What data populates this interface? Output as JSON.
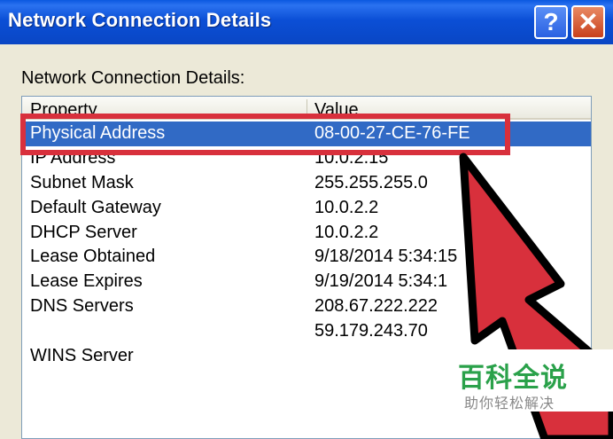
{
  "window": {
    "title": "Network Connection Details",
    "help_label": "?",
    "close_label": "✕"
  },
  "panel": {
    "group_label": "Network Connection Details:"
  },
  "table": {
    "columns": [
      "Property",
      "Value"
    ],
    "rows": [
      {
        "property": "Physical Address",
        "value": "08-00-27-CE-76-FE"
      },
      {
        "property": "IP Address",
        "value": "10.0.2.15"
      },
      {
        "property": "Subnet Mask",
        "value": "255.255.255.0"
      },
      {
        "property": "Default Gateway",
        "value": "10.0.2.2"
      },
      {
        "property": "DHCP Server",
        "value": "10.0.2.2"
      },
      {
        "property": "Lease Obtained",
        "value": "9/18/2014 5:34:15"
      },
      {
        "property": "Lease Expires",
        "value": "9/19/2014 5:34:1"
      },
      {
        "property": "DNS Servers",
        "value": "208.67.222.222"
      },
      {
        "property": "",
        "value": "59.179.243.70"
      },
      {
        "property": "WINS Server",
        "value": ""
      }
    ],
    "selected_row": 0
  },
  "watermark": {
    "main": "百科全说",
    "sub": "助你轻松解决"
  },
  "colors": {
    "titlebar": "#0a4fd6",
    "selection": "#316ac5",
    "annotation_red": "#d8303c",
    "watermark_green": "#2aa14a"
  }
}
